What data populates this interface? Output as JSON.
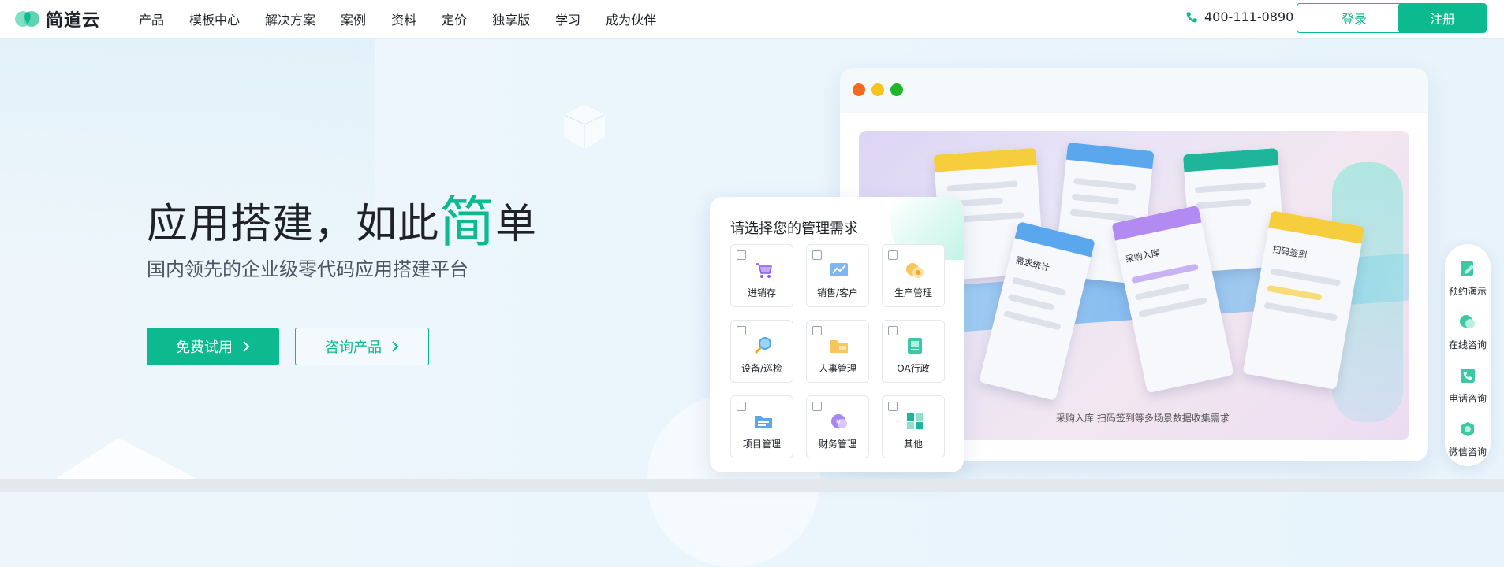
{
  "brand": {
    "name": "简道云",
    "accent": "#0db98f"
  },
  "nav": [
    {
      "label": "产品"
    },
    {
      "label": "模板中心"
    },
    {
      "label": "解决方案"
    },
    {
      "label": "案例"
    },
    {
      "label": "资料"
    },
    {
      "label": "定价"
    },
    {
      "label": "独享版"
    },
    {
      "label": "学习"
    },
    {
      "label": "成为伙伴"
    }
  ],
  "header": {
    "phone": "400-111-0890",
    "login_label": "登录",
    "register_label": "注册"
  },
  "hero": {
    "title_before": "应用搭建，如此",
    "title_accent": "简",
    "title_after": "单",
    "subtitle": "国内领先的企业级零代码应用搭建平台",
    "trial_label": "免费试用",
    "consult_label": "咨询产品"
  },
  "mockup": {
    "caption": "采购入库  扫码签到等多场景数据收集需求",
    "cards": [
      {
        "label": "需求统计",
        "color": "#5aa7ee"
      },
      {
        "label": "采购入库",
        "color": "#b38af1"
      },
      {
        "label": "扫码签到",
        "color": "#f6cd3d"
      }
    ]
  },
  "selector": {
    "title": "请选择您的管理需求",
    "options": [
      {
        "label": "进销存",
        "icon": "cart-icon"
      },
      {
        "label": "销售/客户",
        "icon": "sales-chart-icon"
      },
      {
        "label": "生产管理",
        "icon": "production-gear-icon"
      },
      {
        "label": "设备/巡检",
        "icon": "inspection-magnifier-icon"
      },
      {
        "label": "人事管理",
        "icon": "hr-folder-icon"
      },
      {
        "label": "OA行政",
        "icon": "oa-document-icon"
      },
      {
        "label": "项目管理",
        "icon": "project-folder-icon"
      },
      {
        "label": "财务管理",
        "icon": "finance-coin-icon"
      },
      {
        "label": "其他",
        "icon": "other-grid-icon"
      }
    ]
  },
  "side": [
    {
      "label": "预约演示",
      "icon": "demo-edit-icon"
    },
    {
      "label": "在线咨询",
      "icon": "online-chat-icon"
    },
    {
      "label": "电话咨询",
      "icon": "phone-consult-icon"
    },
    {
      "label": "微信咨询",
      "icon": "wechat-icon"
    }
  ]
}
